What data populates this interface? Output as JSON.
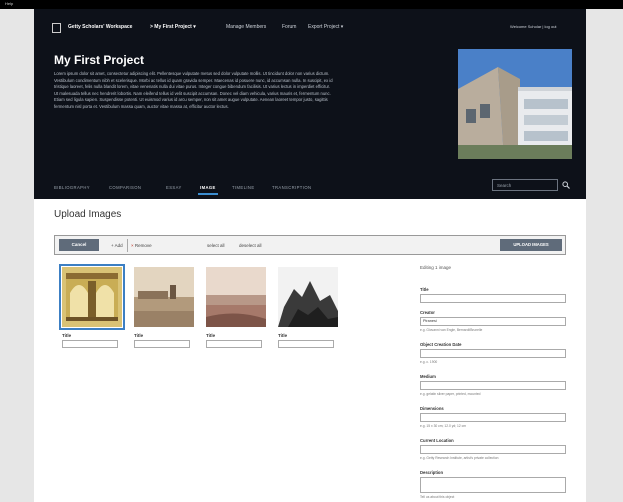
{
  "top": {
    "help": "Help"
  },
  "header": {
    "workspace": "Getty Scholars' Workspace",
    "project_menu": "> My First Project",
    "manage_members": "Manage Members",
    "forum": "Forum",
    "export_project": "Export Project",
    "welcome": "Welcome Scholar | log out"
  },
  "project": {
    "title": "My First Project",
    "description": "Lorem ipsum dolor sit amet, consectetur adipiscing elit. Pellentesque vulputate metus sed dolor vulputate mollis. Ut tincidunt dolor non varius dictum. Vestibulum condimentum nibh et scelerisque. Morbi ac tellus id quam gravida semper. Maecenas id posuere nunc, id accumsan nulla. In suscipit, ex id tristique laoreet, felis nulla blandit lorem, vitae venenatis nulla dui vitae purus. Integer congue bibendum facilisis. Ut varius lectus in imperdiet efficitur. Ut malesuada tellus nec hendrerit lobortis. Nam eleifend tellus id velit suscipit accumsan. Donec vel diam vehicula, varius mauris et, fermentum nunc. Etiam sed ligula sapien. Suspendisse potenti. Ut euismod varius id arcu semper, non sit amet augue vulputate. Aenean laoreet tempor justo, sagittis fermentum nisl porta et. Vestibulum massa quam, auctor vitae massa at, efficitur auctor lectus."
  },
  "tabs": [
    {
      "label": "BIBLIOGRAPHY"
    },
    {
      "label": "COMPARISON"
    },
    {
      "label": "ESSAY"
    },
    {
      "label": "IMAGE"
    },
    {
      "label": "TIMELINE"
    },
    {
      "label": "TRANSCRIPTION"
    }
  ],
  "search": {
    "placeholder": "Search"
  },
  "upload": {
    "title": "Upload Images",
    "cancel": "Cancel",
    "add": "+ Add",
    "remove_x": "×",
    "remove": "Remove",
    "select_all": "select all",
    "deselect_all": "deselect all",
    "upload_btn": "UPLOAD IMAGES"
  },
  "thumbnails": [
    {
      "title_label": "Title"
    },
    {
      "title_label": "Title"
    },
    {
      "title_label": "Title"
    },
    {
      "title_label": "Title"
    }
  ],
  "panel": {
    "heading": "Editing 1 image",
    "title_label": "Title",
    "creator_label": "Creator",
    "creator_value": "Piranesi",
    "creator_hint": "e.g. Giovanni van Engle, Bernardi/Brunelle",
    "date_label": "Object Creation Date",
    "date_hint": "e.g. c. 1900",
    "medium_label": "Medium",
    "medium_hint": "e.g. gelatin silver paper, printed, mounted",
    "dimensions_label": "Dimensions",
    "dimensions_hint": "e.g. 15 x 30 cm; 12.0 yd; 12 cm",
    "location_label": "Current Location",
    "location_hint": "e.g. Getty Research Institute, artist's private collection",
    "description_label": "Description",
    "description_hint": "Tell us about this object"
  },
  "colors": {
    "header_bg": "#0d1119",
    "accent": "#3c8ed0",
    "button": "#5f6b7a"
  }
}
